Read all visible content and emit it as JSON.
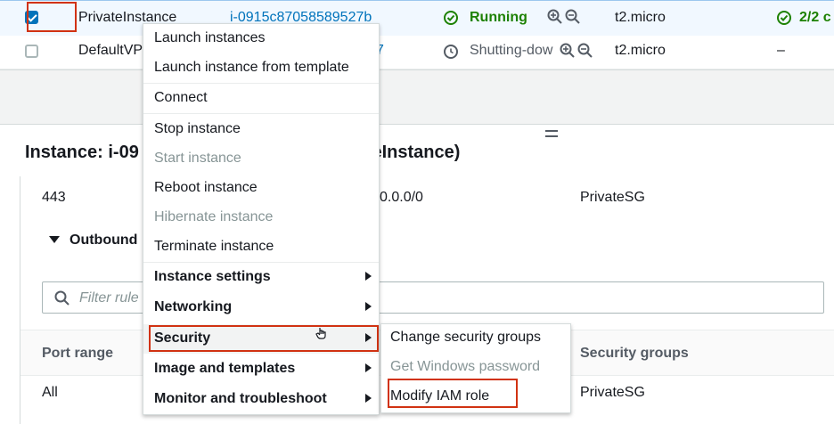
{
  "instances": [
    {
      "checked": true,
      "name": "PrivateInstance",
      "id": "i-0915c87058589527b",
      "state": "Running",
      "type": "t2.micro",
      "status": "2/2 c"
    },
    {
      "checked": false,
      "name": "DefaultVP",
      "id": "7",
      "state": "Shutting-dow",
      "type": "t2.micro",
      "status": "–"
    }
  ],
  "detail": {
    "title_left": "Instance: i-09",
    "title_right": "teInstance)",
    "rule": {
      "port": "443",
      "cidr": "0.0.0/0",
      "sg": "PrivateSG"
    },
    "outbound_label": "Outbound",
    "filter_placeholder": "Filter rule",
    "headers": {
      "port_range": "Port range",
      "security_groups": "Security groups"
    },
    "row": {
      "port": "All",
      "sg": "PrivateSG"
    }
  },
  "context_menu": {
    "items": [
      {
        "label": "Launch instances",
        "disabled": false,
        "bold": false,
        "submenu": false
      },
      {
        "label": "Launch instance from template",
        "disabled": false,
        "bold": false,
        "submenu": false
      },
      {
        "label": "Connect",
        "disabled": false,
        "bold": false,
        "submenu": false
      },
      {
        "label": "Stop instance",
        "disabled": false,
        "bold": false,
        "submenu": false
      },
      {
        "label": "Start instance",
        "disabled": true,
        "bold": false,
        "submenu": false
      },
      {
        "label": "Reboot instance",
        "disabled": false,
        "bold": false,
        "submenu": false
      },
      {
        "label": "Hibernate instance",
        "disabled": true,
        "bold": false,
        "submenu": false
      },
      {
        "label": "Terminate instance",
        "disabled": false,
        "bold": false,
        "submenu": false
      },
      {
        "label": "Instance settings",
        "disabled": false,
        "bold": true,
        "submenu": true
      },
      {
        "label": "Networking",
        "disabled": false,
        "bold": true,
        "submenu": true
      },
      {
        "label": "Security",
        "disabled": false,
        "bold": true,
        "submenu": true
      },
      {
        "label": "Image and templates",
        "disabled": false,
        "bold": true,
        "submenu": true
      },
      {
        "label": "Monitor and troubleshoot",
        "disabled": false,
        "bold": true,
        "submenu": true
      }
    ]
  },
  "security_submenu": {
    "items": [
      {
        "label": "Change security groups",
        "disabled": false
      },
      {
        "label": "Get Windows password",
        "disabled": true
      },
      {
        "label": "Modify IAM role",
        "disabled": false
      }
    ]
  },
  "icons": {
    "running": "check-circle-icon",
    "shutting": "clock-icon",
    "zoom_in": "zoom-in-icon",
    "zoom_out": "zoom-out-icon",
    "search": "search-icon",
    "collapse": "caret-down-icon",
    "submenu": "caret-right-icon",
    "pointer": "hand-cursor-icon"
  },
  "colors": {
    "highlight": "#d13212",
    "link": "#0073bb",
    "success": "#1d8102",
    "disabled": "#879596"
  }
}
